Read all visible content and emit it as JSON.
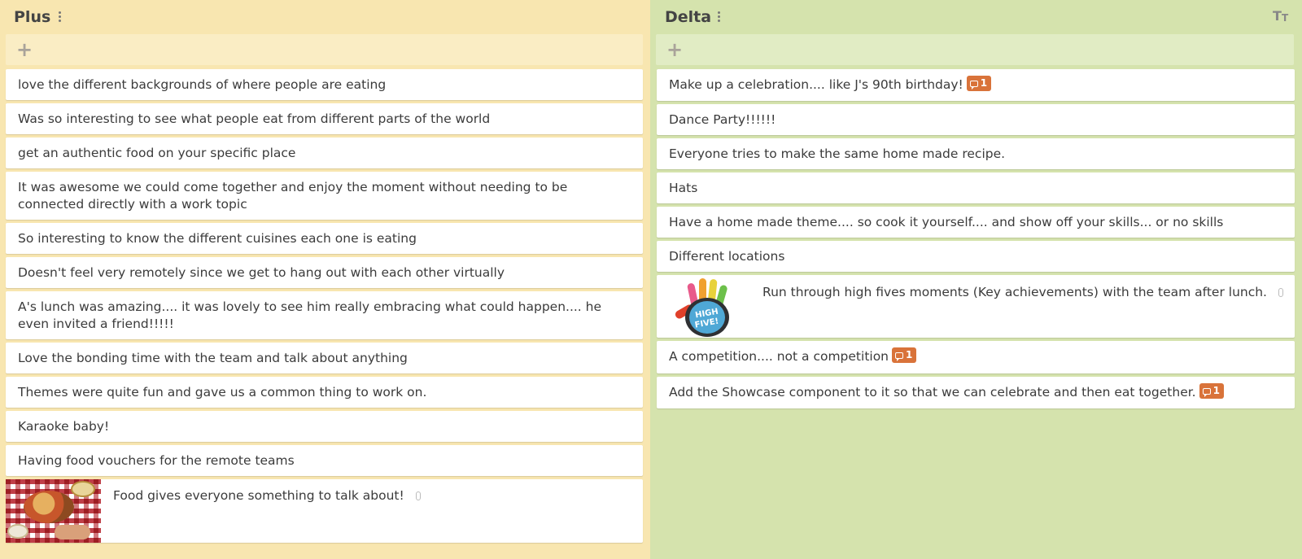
{
  "columns": [
    {
      "title": "Plus",
      "add_label": "+",
      "cards": [
        {
          "text": "love the different backgrounds of where people are eating"
        },
        {
          "text": "Was so interesting to see what people eat from different parts of the world"
        },
        {
          "text": "get an authentic food on your specific place"
        },
        {
          "text": "It was awesome we could come together and enjoy the moment without needing to be connected directly with a work topic"
        },
        {
          "text": "So interesting to know the different cuisines each one is eating"
        },
        {
          "text": "Doesn't feel very remotely since we get to hang out with each other virtually"
        },
        {
          "text": "A's lunch was amazing.... it was lovely to see him really embracing what could happen.... he even invited a friend!!!!!"
        },
        {
          "text": "Love the bonding time with the team and talk about anything"
        },
        {
          "text": "Themes were quite fun and gave us a common thing to work on."
        },
        {
          "text": "Karaoke baby!"
        },
        {
          "text": "Having food vouchers for the remote teams"
        },
        {
          "text": "Food gives everyone something to talk about!",
          "image": "food-photo",
          "attachment_icon": "paperclip-icon"
        }
      ]
    },
    {
      "title": "Delta",
      "add_label": "+",
      "font_size_icon": "text-size-icon",
      "cards": [
        {
          "text": "Make up a celebration.... like J's 90th birthday!",
          "comments": "1"
        },
        {
          "text": "Dance Party!!!!!!"
        },
        {
          "text": "Everyone tries to make the same home made recipe."
        },
        {
          "text": "Hats"
        },
        {
          "text": "Have a home made theme.... so cook it yourself.... and show off your skills... or no skills"
        },
        {
          "text": "Different locations"
        },
        {
          "text": "Run through high fives moments (Key achievements) with the team after lunch.",
          "image": "high-five-hand",
          "image_text": "HIGH FIVE!",
          "attachment_icon": "paperclip-icon"
        },
        {
          "text": "A competition.... not a competition",
          "comments": "1"
        },
        {
          "text": "Add the Showcase component to it so that we can celebrate and then eat together.",
          "comments": "1"
        }
      ]
    }
  ],
  "colors": {
    "plus_bg": "#f8e6b0",
    "delta_bg": "#d5e3ad",
    "comment_badge": "#d9733a"
  }
}
